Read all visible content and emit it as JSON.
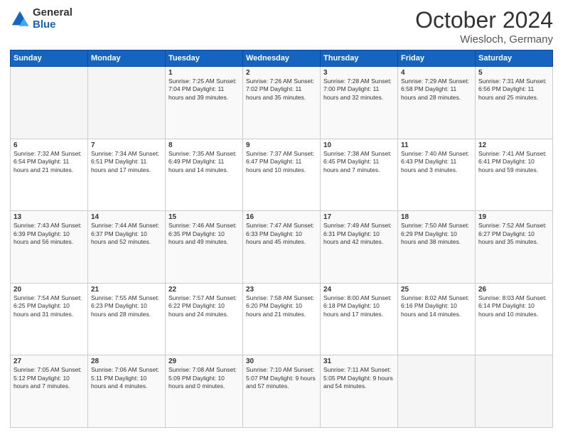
{
  "logo": {
    "general": "General",
    "blue": "Blue"
  },
  "header": {
    "title": "October 2024",
    "location": "Wiesloch, Germany"
  },
  "days": [
    "Sunday",
    "Monday",
    "Tuesday",
    "Wednesday",
    "Thursday",
    "Friday",
    "Saturday"
  ],
  "weeks": [
    [
      {
        "day": "",
        "info": ""
      },
      {
        "day": "",
        "info": ""
      },
      {
        "day": "1",
        "info": "Sunrise: 7:25 AM\nSunset: 7:04 PM\nDaylight: 11 hours\nand 39 minutes."
      },
      {
        "day": "2",
        "info": "Sunrise: 7:26 AM\nSunset: 7:02 PM\nDaylight: 11 hours\nand 35 minutes."
      },
      {
        "day": "3",
        "info": "Sunrise: 7:28 AM\nSunset: 7:00 PM\nDaylight: 11 hours\nand 32 minutes."
      },
      {
        "day": "4",
        "info": "Sunrise: 7:29 AM\nSunset: 6:58 PM\nDaylight: 11 hours\nand 28 minutes."
      },
      {
        "day": "5",
        "info": "Sunrise: 7:31 AM\nSunset: 6:56 PM\nDaylight: 11 hours\nand 25 minutes."
      }
    ],
    [
      {
        "day": "6",
        "info": "Sunrise: 7:32 AM\nSunset: 6:54 PM\nDaylight: 11 hours\nand 21 minutes."
      },
      {
        "day": "7",
        "info": "Sunrise: 7:34 AM\nSunset: 6:51 PM\nDaylight: 11 hours\nand 17 minutes."
      },
      {
        "day": "8",
        "info": "Sunrise: 7:35 AM\nSunset: 6:49 PM\nDaylight: 11 hours\nand 14 minutes."
      },
      {
        "day": "9",
        "info": "Sunrise: 7:37 AM\nSunset: 6:47 PM\nDaylight: 11 hours\nand 10 minutes."
      },
      {
        "day": "10",
        "info": "Sunrise: 7:38 AM\nSunset: 6:45 PM\nDaylight: 11 hours\nand 7 minutes."
      },
      {
        "day": "11",
        "info": "Sunrise: 7:40 AM\nSunset: 6:43 PM\nDaylight: 11 hours\nand 3 minutes."
      },
      {
        "day": "12",
        "info": "Sunrise: 7:41 AM\nSunset: 6:41 PM\nDaylight: 10 hours\nand 59 minutes."
      }
    ],
    [
      {
        "day": "13",
        "info": "Sunrise: 7:43 AM\nSunset: 6:39 PM\nDaylight: 10 hours\nand 56 minutes."
      },
      {
        "day": "14",
        "info": "Sunrise: 7:44 AM\nSunset: 6:37 PM\nDaylight: 10 hours\nand 52 minutes."
      },
      {
        "day": "15",
        "info": "Sunrise: 7:46 AM\nSunset: 6:35 PM\nDaylight: 10 hours\nand 49 minutes."
      },
      {
        "day": "16",
        "info": "Sunrise: 7:47 AM\nSunset: 6:33 PM\nDaylight: 10 hours\nand 45 minutes."
      },
      {
        "day": "17",
        "info": "Sunrise: 7:49 AM\nSunset: 6:31 PM\nDaylight: 10 hours\nand 42 minutes."
      },
      {
        "day": "18",
        "info": "Sunrise: 7:50 AM\nSunset: 6:29 PM\nDaylight: 10 hours\nand 38 minutes."
      },
      {
        "day": "19",
        "info": "Sunrise: 7:52 AM\nSunset: 6:27 PM\nDaylight: 10 hours\nand 35 minutes."
      }
    ],
    [
      {
        "day": "20",
        "info": "Sunrise: 7:54 AM\nSunset: 6:25 PM\nDaylight: 10 hours\nand 31 minutes."
      },
      {
        "day": "21",
        "info": "Sunrise: 7:55 AM\nSunset: 6:23 PM\nDaylight: 10 hours\nand 28 minutes."
      },
      {
        "day": "22",
        "info": "Sunrise: 7:57 AM\nSunset: 6:22 PM\nDaylight: 10 hours\nand 24 minutes."
      },
      {
        "day": "23",
        "info": "Sunrise: 7:58 AM\nSunset: 6:20 PM\nDaylight: 10 hours\nand 21 minutes."
      },
      {
        "day": "24",
        "info": "Sunrise: 8:00 AM\nSunset: 6:18 PM\nDaylight: 10 hours\nand 17 minutes."
      },
      {
        "day": "25",
        "info": "Sunrise: 8:02 AM\nSunset: 6:16 PM\nDaylight: 10 hours\nand 14 minutes."
      },
      {
        "day": "26",
        "info": "Sunrise: 8:03 AM\nSunset: 6:14 PM\nDaylight: 10 hours\nand 10 minutes."
      }
    ],
    [
      {
        "day": "27",
        "info": "Sunrise: 7:05 AM\nSunset: 5:12 PM\nDaylight: 10 hours\nand 7 minutes."
      },
      {
        "day": "28",
        "info": "Sunrise: 7:06 AM\nSunset: 5:11 PM\nDaylight: 10 hours\nand 4 minutes."
      },
      {
        "day": "29",
        "info": "Sunrise: 7:08 AM\nSunset: 5:09 PM\nDaylight: 10 hours\nand 0 minutes."
      },
      {
        "day": "30",
        "info": "Sunrise: 7:10 AM\nSunset: 5:07 PM\nDaylight: 9 hours\nand 57 minutes."
      },
      {
        "day": "31",
        "info": "Sunrise: 7:11 AM\nSunset: 5:05 PM\nDaylight: 9 hours\nand 54 minutes."
      },
      {
        "day": "",
        "info": ""
      },
      {
        "day": "",
        "info": ""
      }
    ]
  ]
}
